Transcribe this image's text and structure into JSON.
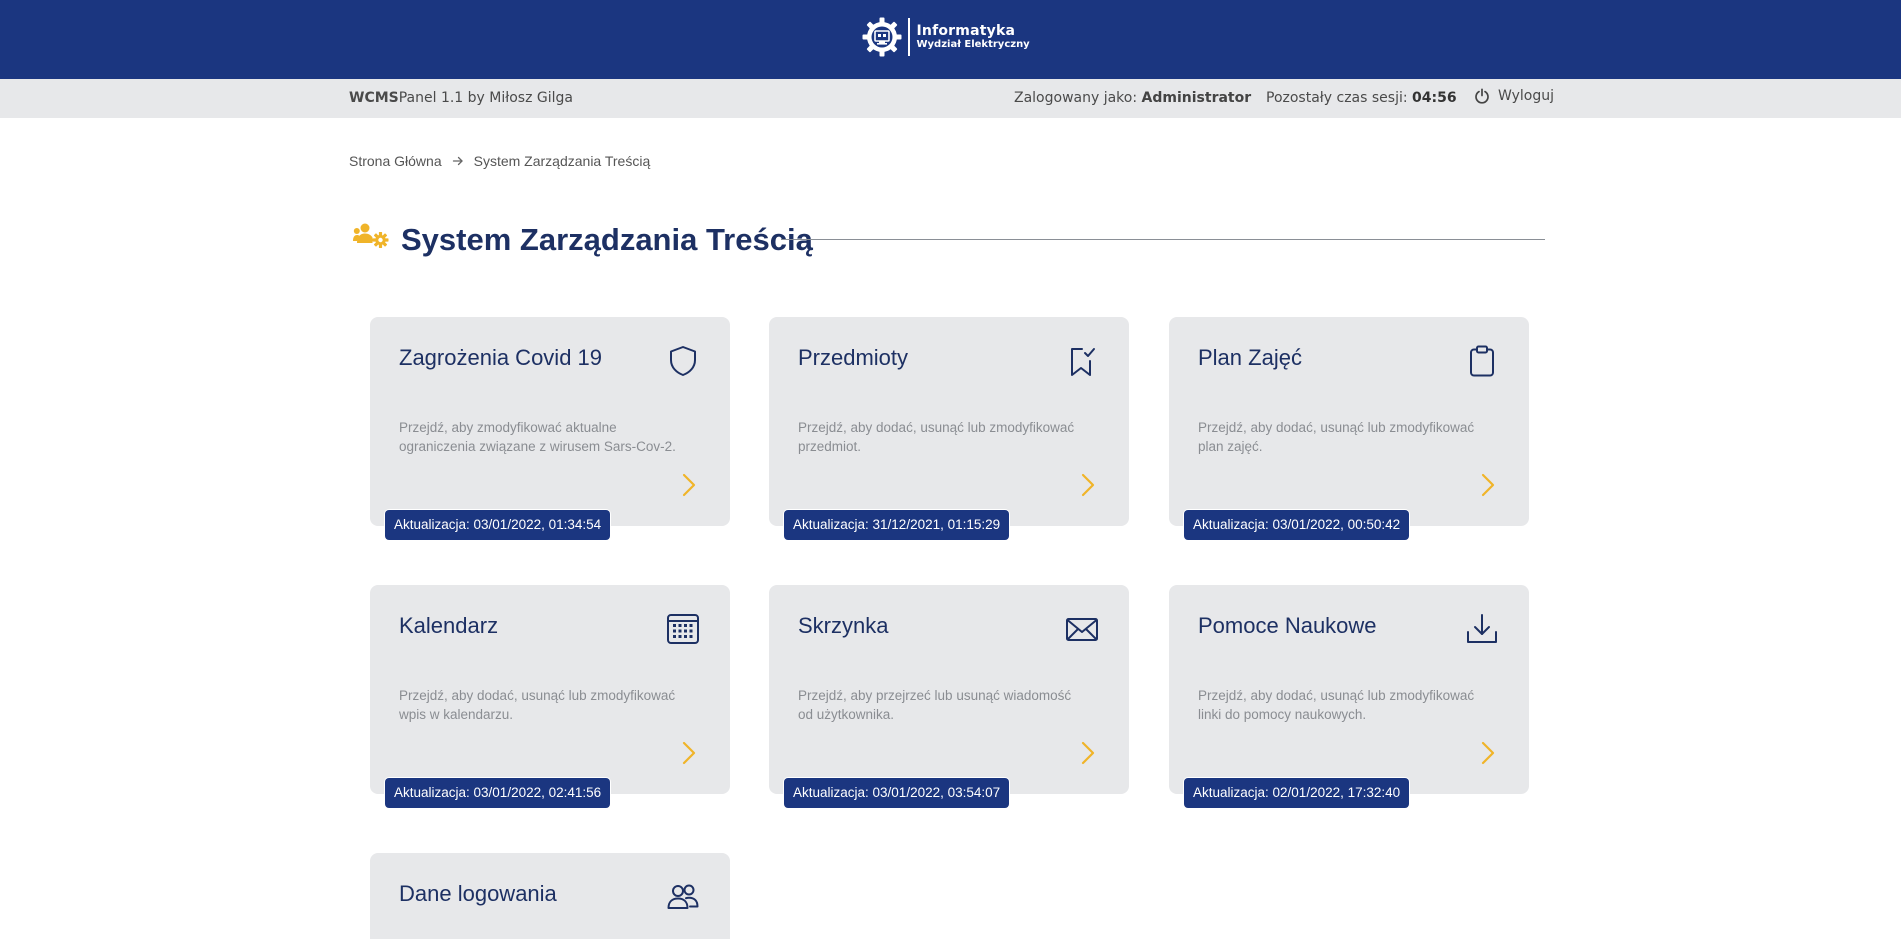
{
  "header": {
    "logo_title": "Informatyka",
    "logo_subtitle": "Wydział Elektryczny"
  },
  "session_bar": {
    "brand_bold": "WCMS",
    "brand_rest": "Panel 1.1 by Miłosz Gilga",
    "logged_label": "Zalogowany jako:",
    "logged_user": "Administrator",
    "session_label": "Pozostały czas sesji:",
    "session_time": "04:56",
    "logout_label": "Wyloguj"
  },
  "breadcrumb": {
    "home": "Strona Główna",
    "current": "System Zarządzania Treścią"
  },
  "page": {
    "title": "System Zarządzania Treścią"
  },
  "cards": [
    {
      "title": "Zagrożenia Covid 19",
      "icon": "shield-icon",
      "description": "Przejdź, aby zmodyfikować aktualne ograniczenia związane z wirusem Sars-Cov-2.",
      "updated": "Aktualizacja: 03/01/2022, 01:34:54"
    },
    {
      "title": "Przedmioty",
      "icon": "bookmark-check-icon",
      "description": "Przejdź, aby dodać, usunąć lub zmodyfikować przedmiot.",
      "updated": "Aktualizacja: 31/12/2021, 01:15:29"
    },
    {
      "title": "Plan Zajęć",
      "icon": "clipboard-icon",
      "description": "Przejdź, aby dodać, usunąć lub zmodyfikować plan zajęć.",
      "updated": "Aktualizacja: 03/01/2022, 00:50:42"
    },
    {
      "title": "Kalendarz",
      "icon": "calendar-icon",
      "description": "Przejdź, aby dodać, usunąć lub zmodyfikować wpis w kalendarzu.",
      "updated": "Aktualizacja: 03/01/2022, 02:41:56"
    },
    {
      "title": "Skrzynka",
      "icon": "envelope-icon",
      "description": "Przejdź, aby przejrzeć lub usunąć wiadomość od użytkownika.",
      "updated": "Aktualizacja: 03/01/2022, 03:54:07"
    },
    {
      "title": "Pomoce Naukowe",
      "icon": "download-icon",
      "description": "Przejdź, aby dodać, usunąć lub zmodyfikować linki do pomocy naukowych.",
      "updated": "Aktualizacja: 02/01/2022, 17:32:40"
    },
    {
      "title": "Dane logowania",
      "icon": "users-icon",
      "description": "",
      "updated": ""
    }
  ],
  "colors": {
    "brand_blue": "#1b3680",
    "accent_yellow": "#f0b429",
    "card_bg": "#e7e8ea",
    "title_navy": "#1d3063"
  }
}
